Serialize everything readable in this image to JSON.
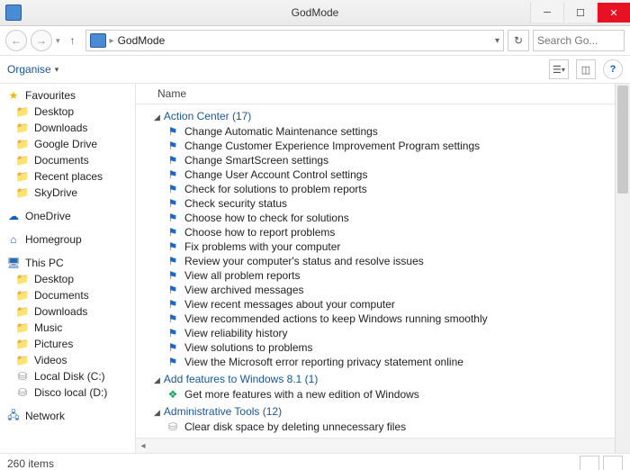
{
  "title": "GodMode",
  "address": {
    "location": "GodMode"
  },
  "search": {
    "placeholder": "Search Go..."
  },
  "toolbar": {
    "organise": "Organise"
  },
  "columnHeader": "Name",
  "sidebar": {
    "favourites": {
      "label": "Favourites",
      "items": [
        "Desktop",
        "Downloads",
        "Google Drive",
        "Documents",
        "Recent places",
        "SkyDrive"
      ]
    },
    "onedrive": "OneDrive",
    "homegroup": "Homegroup",
    "thispc": {
      "label": "This PC",
      "items": [
        "Desktop",
        "Documents",
        "Downloads",
        "Music",
        "Pictures",
        "Videos",
        "Local Disk (C:)",
        "Disco local (D:)"
      ]
    },
    "network": "Network"
  },
  "groups": [
    {
      "title": "Action Center",
      "count": 17,
      "icon": "flag",
      "items": [
        "Change Automatic Maintenance settings",
        "Change Customer Experience Improvement Program settings",
        "Change SmartScreen settings",
        "Change User Account Control settings",
        "Check for solutions to problem reports",
        "Check security status",
        "Choose how to check for solutions",
        "Choose how to report problems",
        "Fix problems with your computer",
        "Review your computer's status and resolve issues",
        "View all problem reports",
        "View archived messages",
        "View recent messages about your computer",
        "View recommended actions to keep Windows running smoothly",
        "View reliability history",
        "View solutions to problems",
        "View the Microsoft error reporting privacy statement online"
      ]
    },
    {
      "title": "Add features to Windows 8.1",
      "count": 1,
      "icon": "feat",
      "items": [
        "Get more features with a new edition of Windows"
      ]
    },
    {
      "title": "Administrative Tools",
      "count": 12,
      "icon": "live",
      "items": [
        "Clear disk space by deleting unnecessary files"
      ]
    }
  ],
  "status": {
    "items": "260 items"
  }
}
